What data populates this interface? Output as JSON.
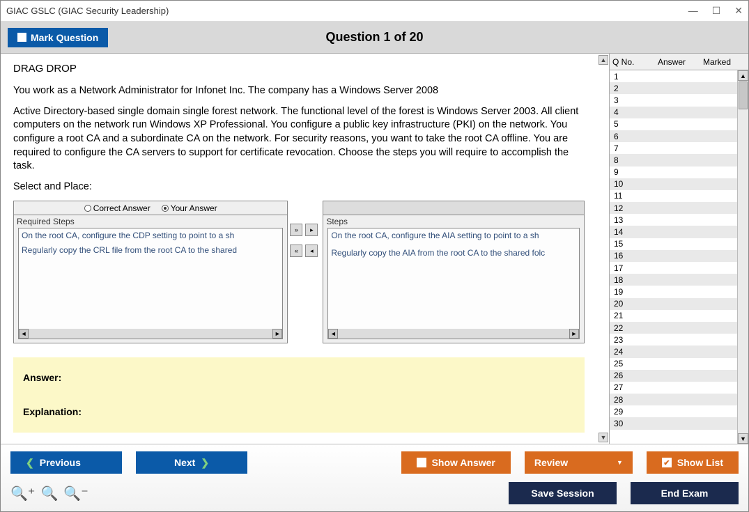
{
  "title": "GIAC GSLC (GIAC Security Leadership)",
  "header": {
    "mark_label": "Mark Question",
    "question_title": "Question 1 of 20"
  },
  "question": {
    "type_label": "DRAG DROP",
    "intro": "You work as a Network Administrator for Infonet Inc. The company has a Windows Server 2008",
    "body": "Active Directory-based single domain single forest network. The functional level of the forest is Windows Server 2003. All client computers on the network run Windows XP Professional. You configure a public key infrastructure (PKI) on the network. You configure a root CA and a subordinate CA on the network. For security reasons, you want to take the root CA offline. You are required to configure the CA servers to support for certificate revocation. Choose the steps you will require to accomplish the task.",
    "select_label": "Select and Place:"
  },
  "drag": {
    "radio_correct": "Correct Answer",
    "radio_your": "Your Answer",
    "left_header": "Required Steps",
    "right_header": "Steps",
    "left_items": [
      "On the root CA, configure the CDP setting to point to a sh",
      "Regularly copy the CRL file from the root CA to the shared"
    ],
    "right_items": [
      "On the root CA, configure the AIA setting to point to a sh",
      "",
      "Regularly copy the AIA from the root CA to the shared folc"
    ]
  },
  "answer_box": {
    "answer_label": "Answer:",
    "explanation_label": "Explanation:"
  },
  "side": {
    "col_qno": "Q No.",
    "col_answer": "Answer",
    "col_marked": "Marked",
    "rows": [
      "1",
      "2",
      "3",
      "4",
      "5",
      "6",
      "7",
      "8",
      "9",
      "10",
      "11",
      "12",
      "13",
      "14",
      "15",
      "16",
      "17",
      "18",
      "19",
      "20",
      "21",
      "22",
      "23",
      "24",
      "25",
      "26",
      "27",
      "28",
      "29",
      "30"
    ]
  },
  "footer": {
    "previous": "Previous",
    "next": "Next",
    "show_answer": "Show Answer",
    "review": "Review",
    "show_list": "Show List",
    "save_session": "Save Session",
    "end_exam": "End Exam"
  }
}
